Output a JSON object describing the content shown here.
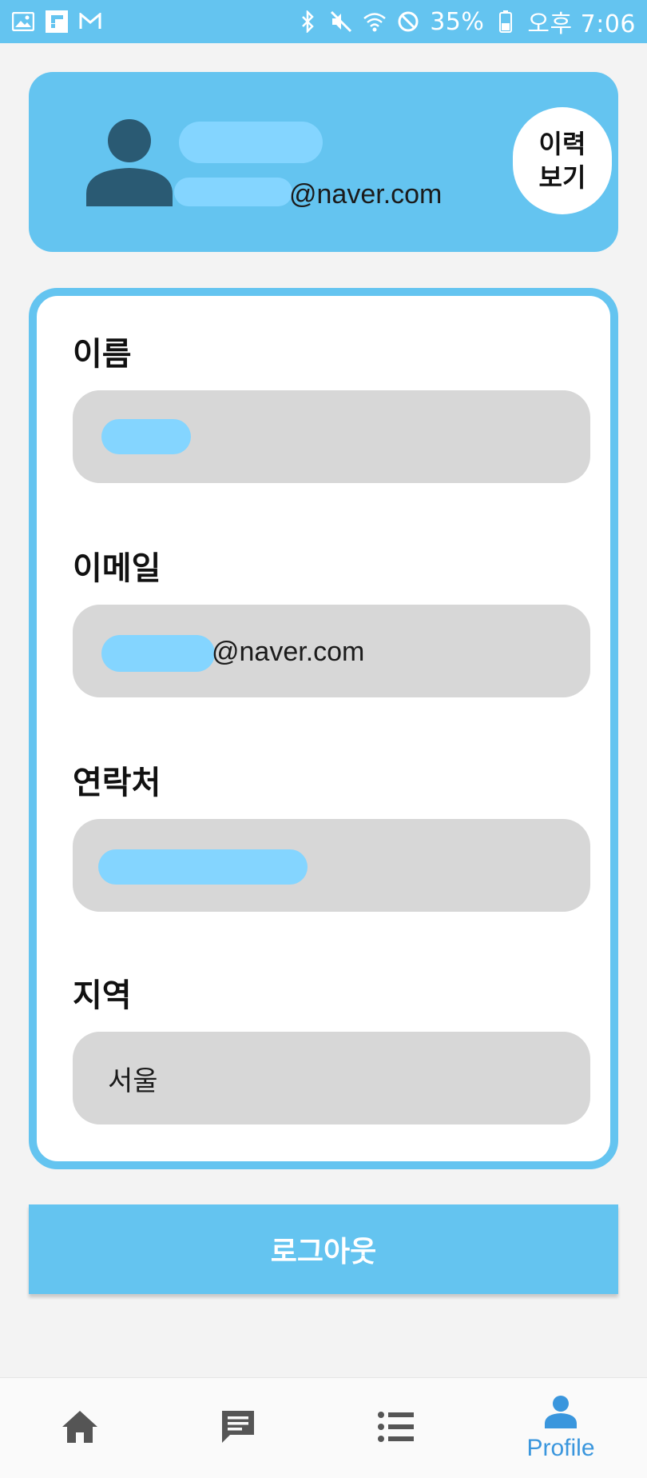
{
  "status_bar": {
    "battery": "35%",
    "time": "오후 7:06",
    "icons": [
      "image-icon",
      "flipboard-icon",
      "gmail-icon",
      "bluetooth-icon",
      "mute-icon",
      "wifi-icon",
      "do-not-disturb-icon",
      "battery-icon"
    ]
  },
  "profile": {
    "email_suffix": "@naver.com",
    "history_button_label": "이력\n보기",
    "avatar_icon": "person-icon"
  },
  "form": {
    "name_label": "이름",
    "email_label": "이메일",
    "email_suffix": "@naver.com",
    "phone_label": "연락처",
    "region_label": "지역",
    "region_value": "서울"
  },
  "logout_label": "로그아웃",
  "bottom_nav": {
    "items": [
      {
        "icon": "home-icon",
        "label": ""
      },
      {
        "icon": "chat-icon",
        "label": ""
      },
      {
        "icon": "list-icon",
        "label": ""
      },
      {
        "icon": "profile-icon",
        "label": "Profile"
      }
    ],
    "active_color": "#3a96dd",
    "inactive_color": "#555555"
  },
  "colors": {
    "accent": "#64c4f0",
    "field_bg": "#d7d7d7",
    "redaction": "#84d5ff",
    "avatar": "#2a5a73"
  }
}
